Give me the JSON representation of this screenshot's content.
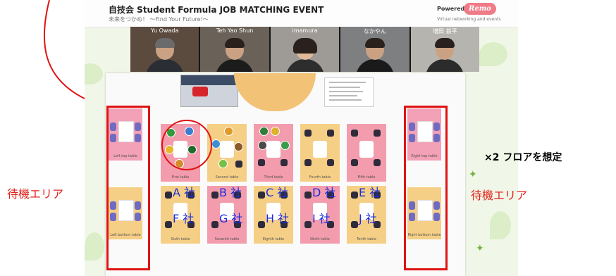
{
  "header": {
    "title": "自技会 Student Formula JOB MATCHING EVENT",
    "subtitle": "未来をつかめ！ 〜Find Your Future!〜",
    "powered_by": "Powered by",
    "brand": "Remo",
    "powered_sub": "Virtual networking and events"
  },
  "video_strip": {
    "participants": [
      {
        "name": "Yu Owada"
      },
      {
        "name": "Teh Yao Shun"
      },
      {
        "name": "imamura"
      },
      {
        "name": "なかやん"
      },
      {
        "name": "増田 鉄平"
      }
    ]
  },
  "rooms": [
    {
      "company": "A 社",
      "label": "First table"
    },
    {
      "company": "B 社",
      "label": "Second table"
    },
    {
      "company": "C 社",
      "label": "Third table"
    },
    {
      "company": "D 社",
      "label": "Fourth table"
    },
    {
      "company": "E 社",
      "label": "Fifth table"
    },
    {
      "company": "F 社",
      "label": "Sixth table"
    },
    {
      "company": "G 社",
      "label": "Seventh table"
    },
    {
      "company": "H 社",
      "label": "Eighth table"
    },
    {
      "company": "I 社",
      "label": "Ninth table"
    },
    {
      "company": "J 社",
      "label": "Tenth table"
    }
  ],
  "waiting_rooms": [
    {
      "label": "Left top table"
    },
    {
      "label": "Left bottom table"
    },
    {
      "label": "Right top table"
    },
    {
      "label": "Right bottom table"
    }
  ],
  "annotations": {
    "waiting_area_left": "待機エリア",
    "waiting_area_right": "待機エリア",
    "floors_note": "×2 フロアを想定"
  },
  "colors": {
    "annotation_red": "#e01313",
    "company_blue": "#1a2de0",
    "room_pink": "#f39cad",
    "room_orange": "#f6cf86",
    "brand_pink": "#ef7b86"
  }
}
